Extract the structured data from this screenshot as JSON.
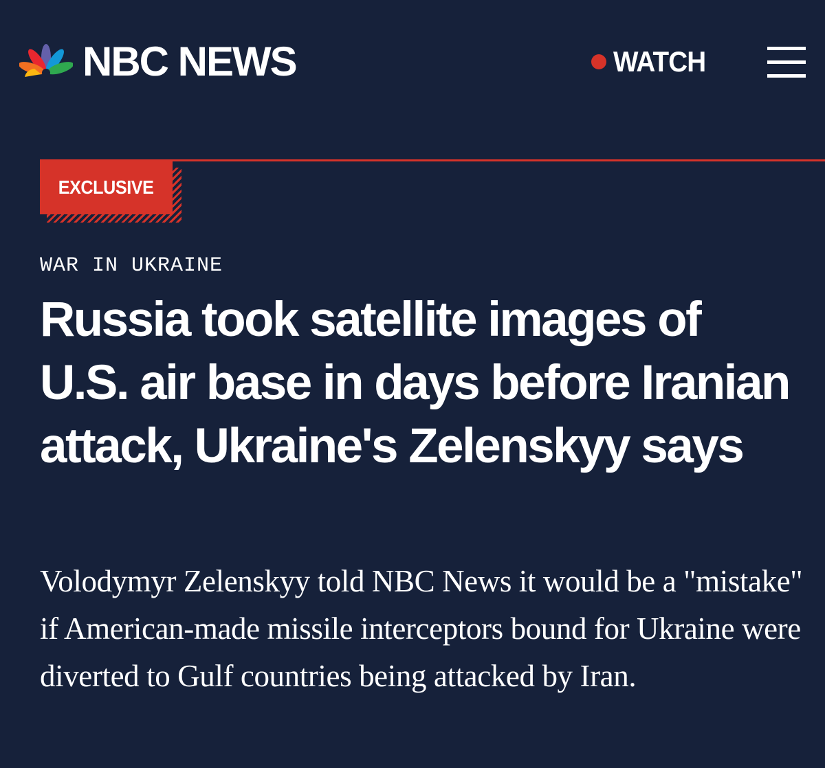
{
  "header": {
    "brand": "NBC NEWS",
    "watch_label": "WATCH",
    "live_color": "#d63329",
    "menu_icon": "hamburger-menu-icon",
    "logo_icon": "nbc-peacock-icon"
  },
  "article": {
    "badge": "EXCLUSIVE",
    "section": "WAR IN UKRAINE",
    "headline": "Russia took satellite images of U.S. air base in days before Iranian attack, Ukraine's Zelenskyy says",
    "dek": "Volodymyr Zelenskyy told NBC News it would be a \"mistake\" if American-made missile interceptors bound for Ukraine were diverted to Gulf countries being attacked by Iran."
  },
  "colors": {
    "background": "#16213a",
    "accent": "#d63329",
    "text": "#ffffff"
  }
}
